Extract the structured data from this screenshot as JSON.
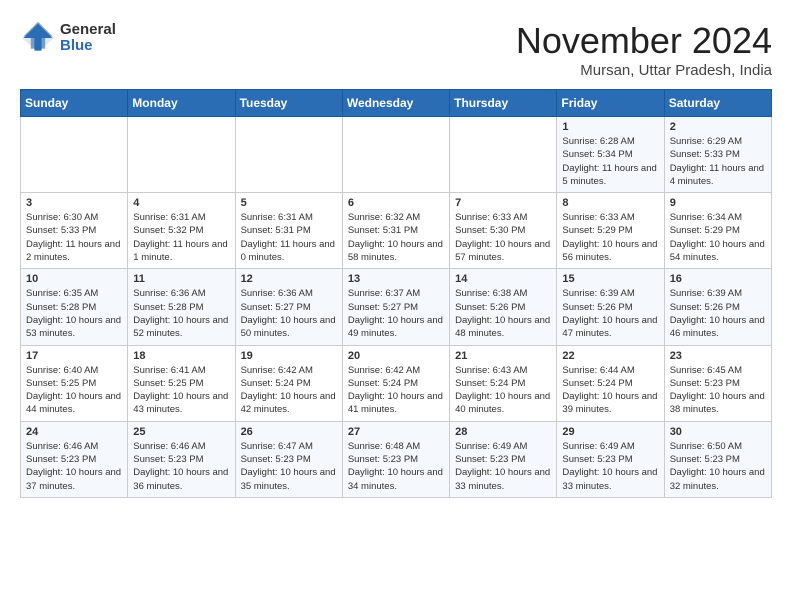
{
  "header": {
    "logo_general": "General",
    "logo_blue": "Blue",
    "month_title": "November 2024",
    "location": "Mursan, Uttar Pradesh, India"
  },
  "days_of_week": [
    "Sunday",
    "Monday",
    "Tuesday",
    "Wednesday",
    "Thursday",
    "Friday",
    "Saturday"
  ],
  "weeks": [
    [
      {
        "day": "",
        "info": ""
      },
      {
        "day": "",
        "info": ""
      },
      {
        "day": "",
        "info": ""
      },
      {
        "day": "",
        "info": ""
      },
      {
        "day": "",
        "info": ""
      },
      {
        "day": "1",
        "info": "Sunrise: 6:28 AM\nSunset: 5:34 PM\nDaylight: 11 hours and 5 minutes."
      },
      {
        "day": "2",
        "info": "Sunrise: 6:29 AM\nSunset: 5:33 PM\nDaylight: 11 hours and 4 minutes."
      }
    ],
    [
      {
        "day": "3",
        "info": "Sunrise: 6:30 AM\nSunset: 5:33 PM\nDaylight: 11 hours and 2 minutes."
      },
      {
        "day": "4",
        "info": "Sunrise: 6:31 AM\nSunset: 5:32 PM\nDaylight: 11 hours and 1 minute."
      },
      {
        "day": "5",
        "info": "Sunrise: 6:31 AM\nSunset: 5:31 PM\nDaylight: 11 hours and 0 minutes."
      },
      {
        "day": "6",
        "info": "Sunrise: 6:32 AM\nSunset: 5:31 PM\nDaylight: 10 hours and 58 minutes."
      },
      {
        "day": "7",
        "info": "Sunrise: 6:33 AM\nSunset: 5:30 PM\nDaylight: 10 hours and 57 minutes."
      },
      {
        "day": "8",
        "info": "Sunrise: 6:33 AM\nSunset: 5:29 PM\nDaylight: 10 hours and 56 minutes."
      },
      {
        "day": "9",
        "info": "Sunrise: 6:34 AM\nSunset: 5:29 PM\nDaylight: 10 hours and 54 minutes."
      }
    ],
    [
      {
        "day": "10",
        "info": "Sunrise: 6:35 AM\nSunset: 5:28 PM\nDaylight: 10 hours and 53 minutes."
      },
      {
        "day": "11",
        "info": "Sunrise: 6:36 AM\nSunset: 5:28 PM\nDaylight: 10 hours and 52 minutes."
      },
      {
        "day": "12",
        "info": "Sunrise: 6:36 AM\nSunset: 5:27 PM\nDaylight: 10 hours and 50 minutes."
      },
      {
        "day": "13",
        "info": "Sunrise: 6:37 AM\nSunset: 5:27 PM\nDaylight: 10 hours and 49 minutes."
      },
      {
        "day": "14",
        "info": "Sunrise: 6:38 AM\nSunset: 5:26 PM\nDaylight: 10 hours and 48 minutes."
      },
      {
        "day": "15",
        "info": "Sunrise: 6:39 AM\nSunset: 5:26 PM\nDaylight: 10 hours and 47 minutes."
      },
      {
        "day": "16",
        "info": "Sunrise: 6:39 AM\nSunset: 5:26 PM\nDaylight: 10 hours and 46 minutes."
      }
    ],
    [
      {
        "day": "17",
        "info": "Sunrise: 6:40 AM\nSunset: 5:25 PM\nDaylight: 10 hours and 44 minutes."
      },
      {
        "day": "18",
        "info": "Sunrise: 6:41 AM\nSunset: 5:25 PM\nDaylight: 10 hours and 43 minutes."
      },
      {
        "day": "19",
        "info": "Sunrise: 6:42 AM\nSunset: 5:24 PM\nDaylight: 10 hours and 42 minutes."
      },
      {
        "day": "20",
        "info": "Sunrise: 6:42 AM\nSunset: 5:24 PM\nDaylight: 10 hours and 41 minutes."
      },
      {
        "day": "21",
        "info": "Sunrise: 6:43 AM\nSunset: 5:24 PM\nDaylight: 10 hours and 40 minutes."
      },
      {
        "day": "22",
        "info": "Sunrise: 6:44 AM\nSunset: 5:24 PM\nDaylight: 10 hours and 39 minutes."
      },
      {
        "day": "23",
        "info": "Sunrise: 6:45 AM\nSunset: 5:23 PM\nDaylight: 10 hours and 38 minutes."
      }
    ],
    [
      {
        "day": "24",
        "info": "Sunrise: 6:46 AM\nSunset: 5:23 PM\nDaylight: 10 hours and 37 minutes."
      },
      {
        "day": "25",
        "info": "Sunrise: 6:46 AM\nSunset: 5:23 PM\nDaylight: 10 hours and 36 minutes."
      },
      {
        "day": "26",
        "info": "Sunrise: 6:47 AM\nSunset: 5:23 PM\nDaylight: 10 hours and 35 minutes."
      },
      {
        "day": "27",
        "info": "Sunrise: 6:48 AM\nSunset: 5:23 PM\nDaylight: 10 hours and 34 minutes."
      },
      {
        "day": "28",
        "info": "Sunrise: 6:49 AM\nSunset: 5:23 PM\nDaylight: 10 hours and 33 minutes."
      },
      {
        "day": "29",
        "info": "Sunrise: 6:49 AM\nSunset: 5:23 PM\nDaylight: 10 hours and 33 minutes."
      },
      {
        "day": "30",
        "info": "Sunrise: 6:50 AM\nSunset: 5:23 PM\nDaylight: 10 hours and 32 minutes."
      }
    ]
  ]
}
